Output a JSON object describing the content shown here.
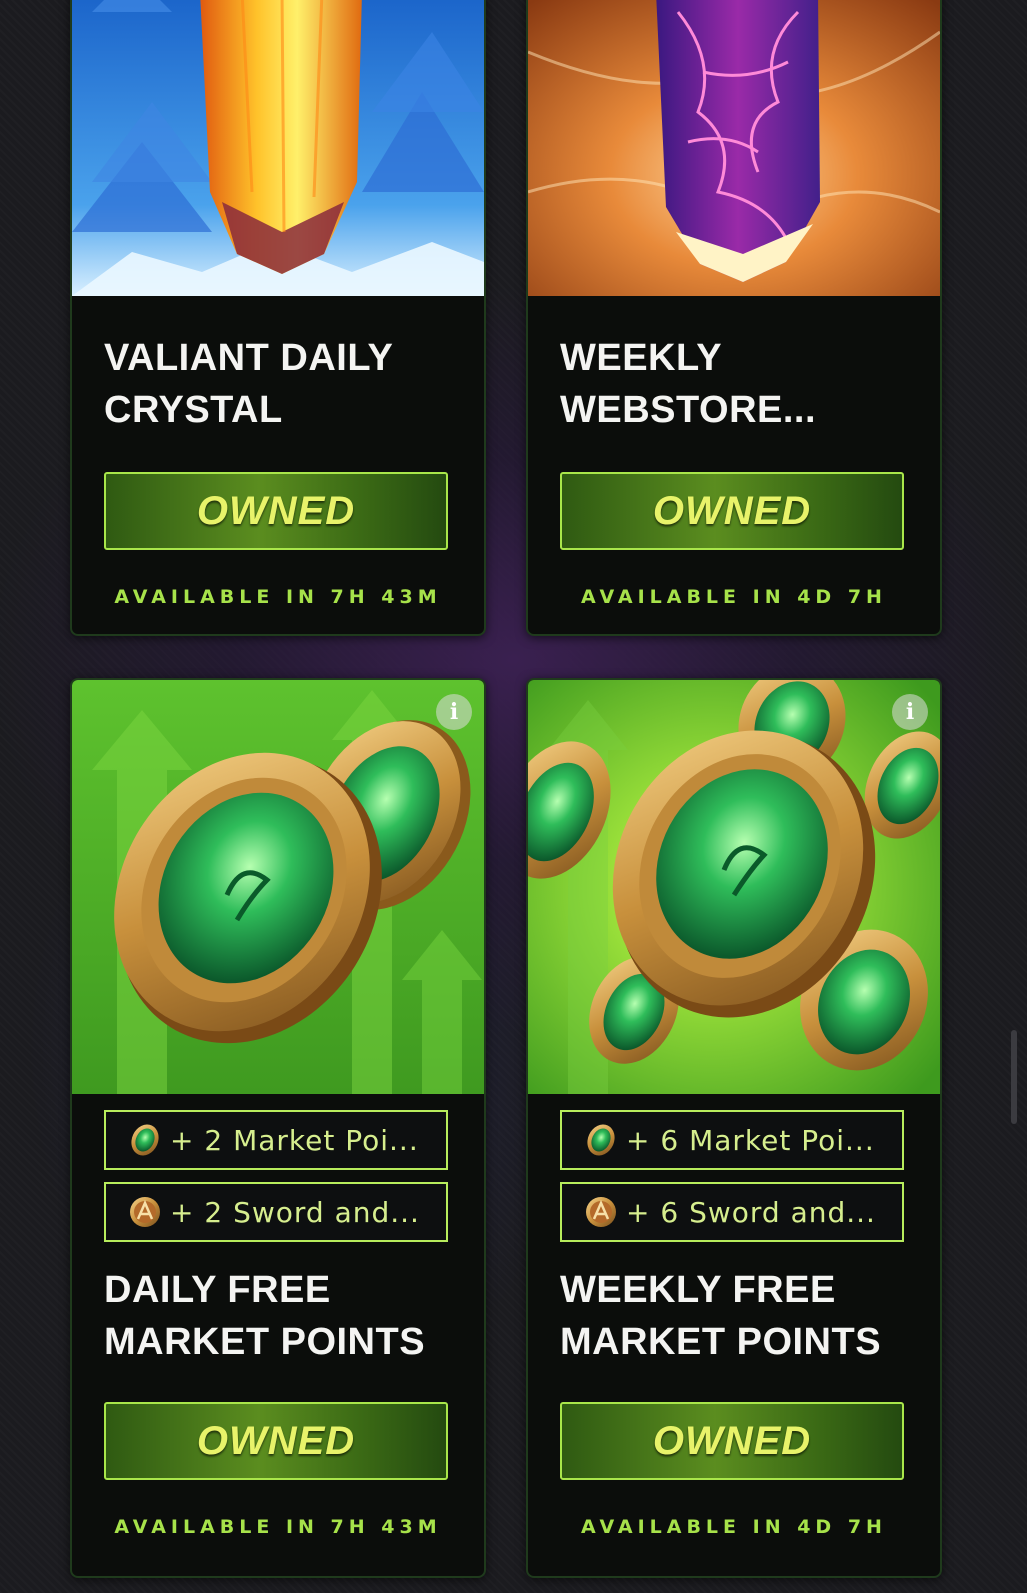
{
  "cards": [
    {
      "title_line1": "VALIANT DAILY",
      "title_line2": "CRYSTAL",
      "button_label": "OWNED",
      "availability": "AVAILABLE IN 7H 43M",
      "image_icon": "golden-crystal-icon"
    },
    {
      "title_line1": "WEEKLY",
      "title_line2": "WEBSTORE...",
      "button_label": "OWNED",
      "availability": "AVAILABLE IN 4D 7H",
      "image_icon": "purple-crystal-icon"
    },
    {
      "title_line1": "DAILY FREE",
      "title_line2": "MARKET POINTS",
      "button_label": "OWNED",
      "availability": "AVAILABLE IN 7H 43M",
      "image_icon": "market-coins-icon",
      "rewards": [
        {
          "icon": "market-point-icon",
          "label": "+ 2 Market Poi..."
        },
        {
          "icon": "sword-shield-token-icon",
          "label": "+ 2 Sword and..."
        }
      ]
    },
    {
      "title_line1": "WEEKLY FREE",
      "title_line2": "MARKET POINTS",
      "button_label": "OWNED",
      "availability": "AVAILABLE IN 4D 7H",
      "image_icon": "market-coins-icon",
      "rewards": [
        {
          "icon": "market-point-icon",
          "label": "+ 6 Market Poi..."
        },
        {
          "icon": "sword-shield-token-icon",
          "label": "+ 6 Sword and..."
        }
      ]
    }
  ],
  "info_icon_glyph": "i",
  "colors": {
    "accent_green": "#a9e64a",
    "owned_text": "#e8f36a",
    "card_bg": "#0b0d0b"
  }
}
